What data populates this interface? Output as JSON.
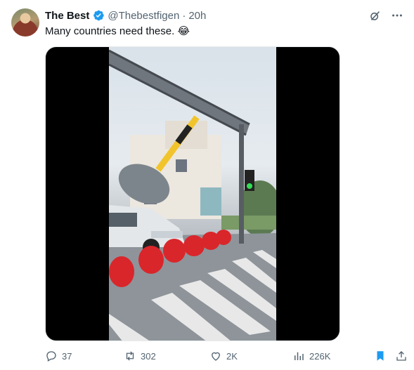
{
  "author": {
    "name": "The Best",
    "handle": "@Thebestfigen",
    "separator": "·",
    "time": "20h"
  },
  "tweet": {
    "text": "Many countries need these.",
    "emoji": "😂"
  },
  "stats": {
    "replies": "37",
    "reposts": "302",
    "likes": "2K",
    "views": "226K"
  },
  "colors": {
    "verified": "#1d9bf0",
    "bookmark": "#1d9bf0",
    "secondary_text": "#536471"
  },
  "icons": [
    "grok-icon",
    "more-icon",
    "reply-icon",
    "repost-icon",
    "like-icon",
    "views-icon",
    "bookmark-icon",
    "share-icon"
  ]
}
